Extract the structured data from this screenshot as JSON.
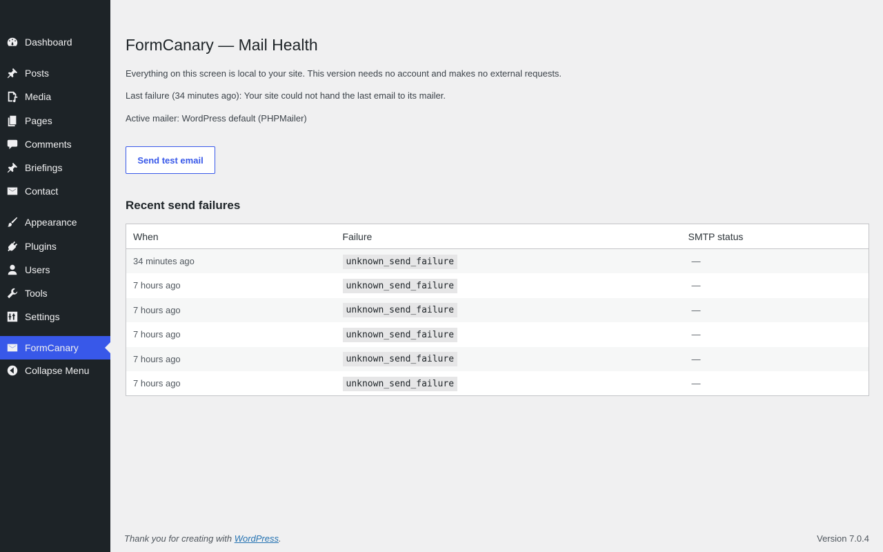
{
  "sidebar": {
    "items": [
      {
        "label": "Dashboard",
        "icon": "dashboard-icon"
      },
      {
        "label": "Posts",
        "icon": "pin-icon"
      },
      {
        "label": "Media",
        "icon": "media-icon"
      },
      {
        "label": "Pages",
        "icon": "pages-icon"
      },
      {
        "label": "Comments",
        "icon": "comment-icon"
      },
      {
        "label": "Briefings",
        "icon": "pin-icon"
      },
      {
        "label": "Contact",
        "icon": "mail-icon"
      },
      {
        "label": "Appearance",
        "icon": "brush-icon"
      },
      {
        "label": "Plugins",
        "icon": "plugin-icon"
      },
      {
        "label": "Users",
        "icon": "user-icon"
      },
      {
        "label": "Tools",
        "icon": "wrench-icon"
      },
      {
        "label": "Settings",
        "icon": "settings-icon"
      },
      {
        "label": "FormCanary",
        "icon": "mail-icon",
        "current": true
      },
      {
        "label": "Collapse Menu",
        "icon": "collapse-icon"
      }
    ]
  },
  "page": {
    "title": "FormCanary — Mail Health",
    "intro": "Everything on this screen is local to your site. This version needs no account and makes no external requests.",
    "last_failure": "Last failure (34 minutes ago): Your site could not hand the last email to its mailer.",
    "active_mailer": "Active mailer: WordPress default (PHPMailer)",
    "test_button": "Send test email",
    "section_title": "Recent send failures"
  },
  "table": {
    "headers": {
      "when": "When",
      "failure": "Failure",
      "smtp": "SMTP status"
    },
    "rows": [
      {
        "when": "34 minutes ago",
        "failure": "unknown_send_failure",
        "smtp": "—"
      },
      {
        "when": "7 hours ago",
        "failure": "unknown_send_failure",
        "smtp": "—"
      },
      {
        "when": "7 hours ago",
        "failure": "unknown_send_failure",
        "smtp": "—"
      },
      {
        "when": "7 hours ago",
        "failure": "unknown_send_failure",
        "smtp": "—"
      },
      {
        "when": "7 hours ago",
        "failure": "unknown_send_failure",
        "smtp": "—"
      },
      {
        "when": "7 hours ago",
        "failure": "unknown_send_failure",
        "smtp": "—"
      }
    ]
  },
  "footer": {
    "thanks_prefix": "Thank you for creating with ",
    "link": "WordPress",
    "thanks_suffix": ".",
    "version": "Version 7.0.4"
  },
  "colors": {
    "sidebar_bg": "#1d2327",
    "accent": "#3858e9",
    "page_bg": "#f0f0f1"
  }
}
